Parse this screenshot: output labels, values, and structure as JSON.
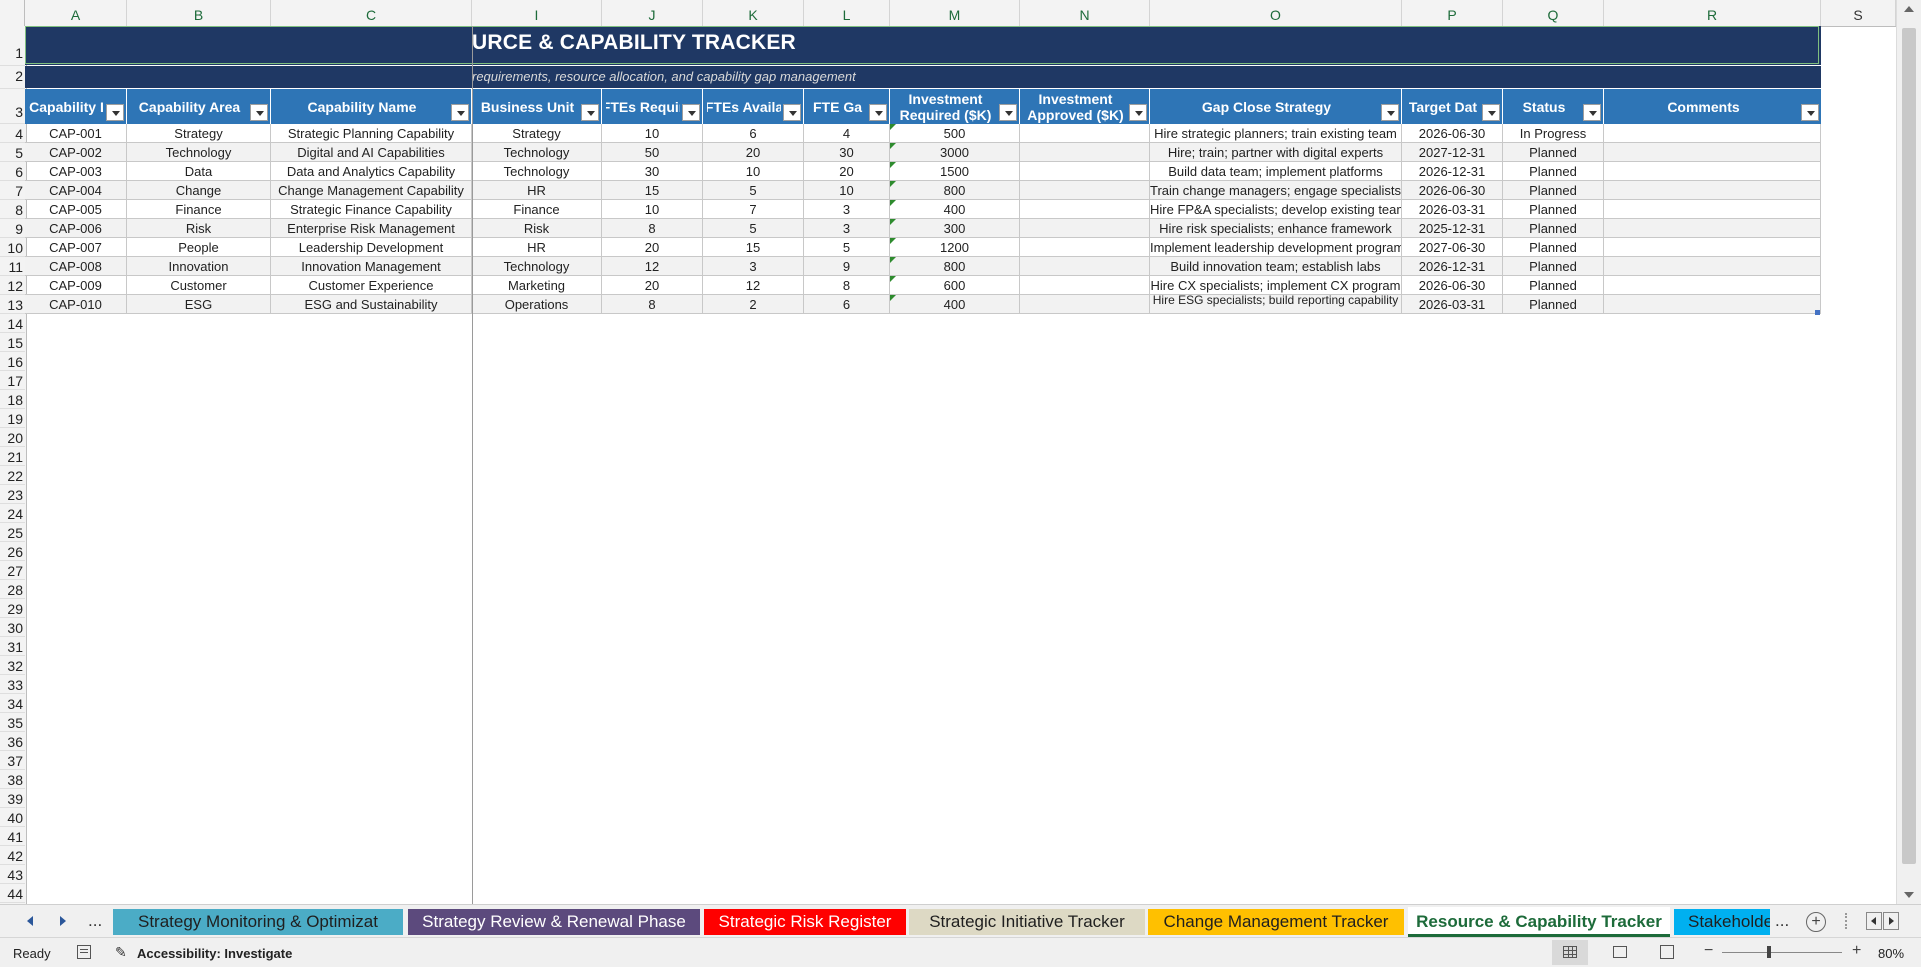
{
  "columns": [
    "A",
    "B",
    "C",
    "I",
    "J",
    "K",
    "L",
    "M",
    "N",
    "O",
    "P",
    "Q",
    "R",
    "S"
  ],
  "title": "URCE & CAPABILITY TRACKER",
  "subtitle": "requirements, resource allocation, and capability gap management",
  "headers": [
    "Capability I",
    "Capability Area",
    "Capability Name",
    "Business Unit",
    "FTEs Requir",
    "FTEs Availa",
    "FTE Ga",
    "Investment Required ($K)",
    "Investment Approved ($K)",
    "Gap Close Strategy",
    "Target Dat",
    "Status",
    "Comments"
  ],
  "row_numbers": [
    "1",
    "2",
    "3",
    "4",
    "5",
    "6",
    "7",
    "8",
    "9",
    "10",
    "11",
    "12",
    "13",
    "14",
    "15",
    "16",
    "17",
    "18",
    "19",
    "20",
    "21",
    "22",
    "23",
    "24",
    "25",
    "26",
    "27",
    "28",
    "29",
    "30",
    "31",
    "32",
    "33",
    "34",
    "35",
    "36",
    "37",
    "38",
    "39",
    "40",
    "41",
    "42",
    "43",
    "44"
  ],
  "rows": [
    [
      "CAP-001",
      "Strategy",
      "Strategic Planning Capability",
      "Strategy",
      "10",
      "6",
      "4",
      "500",
      "",
      "Hire strategic planners; train existing team",
      "2026-06-30",
      "In Progress",
      ""
    ],
    [
      "CAP-002",
      "Technology",
      "Digital and AI Capabilities",
      "Technology",
      "50",
      "20",
      "30",
      "3000",
      "",
      "Hire; train; partner with digital experts",
      "2027-12-31",
      "Planned",
      ""
    ],
    [
      "CAP-003",
      "Data",
      "Data and Analytics Capability",
      "Technology",
      "30",
      "10",
      "20",
      "1500",
      "",
      "Build data team; implement platforms",
      "2026-12-31",
      "Planned",
      ""
    ],
    [
      "CAP-004",
      "Change",
      "Change Management Capability",
      "HR",
      "15",
      "5",
      "10",
      "800",
      "",
      "Train change managers; engage specialists",
      "2026-06-30",
      "Planned",
      ""
    ],
    [
      "CAP-005",
      "Finance",
      "Strategic Finance Capability",
      "Finance",
      "10",
      "7",
      "3",
      "400",
      "",
      "Hire FP&A specialists; develop existing team",
      "2026-03-31",
      "Planned",
      ""
    ],
    [
      "CAP-006",
      "Risk",
      "Enterprise Risk Management",
      "Risk",
      "8",
      "5",
      "3",
      "300",
      "",
      "Hire risk specialists; enhance framework",
      "2025-12-31",
      "Planned",
      ""
    ],
    [
      "CAP-007",
      "People",
      "Leadership Development",
      "HR",
      "20",
      "15",
      "5",
      "1200",
      "",
      "Implement leadership development program",
      "2027-06-30",
      "Planned",
      ""
    ],
    [
      "CAP-008",
      "Innovation",
      "Innovation Management",
      "Technology",
      "12",
      "3",
      "9",
      "800",
      "",
      "Build innovation team; establish labs",
      "2026-12-31",
      "Planned",
      ""
    ],
    [
      "CAP-009",
      "Customer",
      "Customer Experience",
      "Marketing",
      "20",
      "12",
      "8",
      "600",
      "",
      "Hire CX specialists; implement CX program",
      "2026-06-30",
      "Planned",
      ""
    ],
    [
      "CAP-010",
      "ESG",
      "ESG and Sustainability",
      "Operations",
      "8",
      "2",
      "6",
      "400",
      "",
      "Hire ESG specialists; build reporting capability",
      "2026-03-31",
      "Planned",
      ""
    ]
  ],
  "tabs": [
    {
      "label": "Strategy Monitoring & Optimizat",
      "bg": "#4bacc6",
      "fg": "#1f1f1f"
    },
    {
      "label": "Strategy Review & Renewal Phase",
      "bg": "#5c4a7d",
      "fg": "#ffffff"
    },
    {
      "label": "Strategic Risk Register",
      "bg": "#ff0000",
      "fg": "#ffffff"
    },
    {
      "label": "Strategic Initiative Tracker",
      "bg": "#ddd9c4",
      "fg": "#1f1f1f"
    },
    {
      "label": "Change Management Tracker",
      "bg": "#ffc000",
      "fg": "#1f1f1f"
    },
    {
      "label": "Resource & Capability Tracker",
      "bg": "#ffffff",
      "fg": "#1d6b3a"
    },
    {
      "label": "Stakeholde",
      "bg": "#00b0f0",
      "fg": "#1f1f1f"
    }
  ],
  "tab_ellipsis": "...",
  "status": {
    "ready": "Ready",
    "accessibility": "Accessibility: Investigate",
    "zoom": "80%"
  },
  "colors": {
    "title_band": "#1f3864",
    "header": "#2e75b6",
    "active_tab_text": "#1d6b3a"
  }
}
